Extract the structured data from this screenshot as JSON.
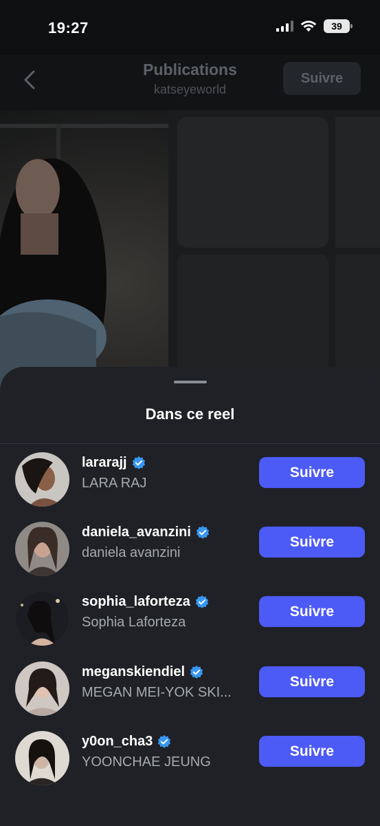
{
  "status_bar": {
    "time": "19:27",
    "battery": "39",
    "icons": [
      "signal-icon",
      "wifi-icon",
      "battery-icon"
    ]
  },
  "header": {
    "title": "Publications",
    "subtitle": "katseyeworld",
    "follow_label": "Suivre",
    "back_icon": "chevron-left-icon"
  },
  "sheet": {
    "title": "Dans ce reel",
    "users": [
      {
        "username": "lararajj",
        "full_name": "LARA RAJ",
        "verified": true,
        "button": "Suivre"
      },
      {
        "username": "daniela_avanzini",
        "full_name": "daniela avanzini",
        "verified": true,
        "button": "Suivre"
      },
      {
        "username": "sophia_laforteza",
        "full_name": "Sophia Laforteza",
        "verified": true,
        "button": "Suivre"
      },
      {
        "username": "meganskiendiel",
        "full_name": "MEGAN MEI-YOK SKI...",
        "verified": true,
        "button": "Suivre"
      },
      {
        "username": "y0on_cha3",
        "full_name": "YOONCHAE JEUNG",
        "verified": true,
        "button": "Suivre"
      }
    ]
  },
  "colors": {
    "accent": "#4c5af6",
    "verified": "#3897f0",
    "sheet_bg": "#1f2126"
  }
}
